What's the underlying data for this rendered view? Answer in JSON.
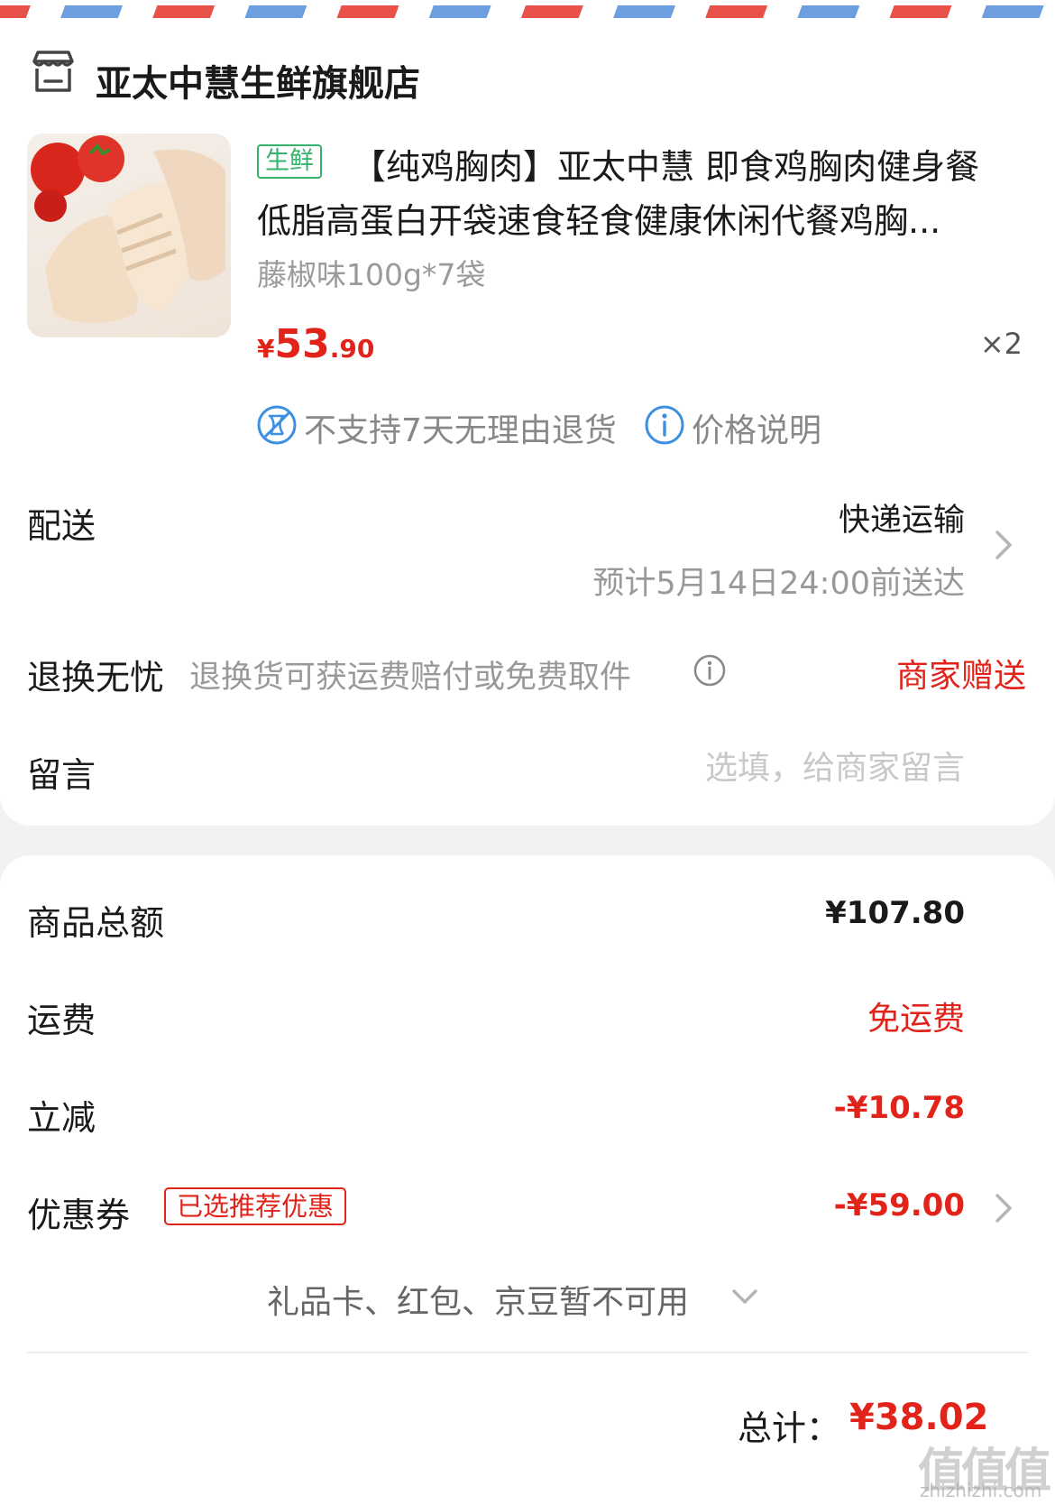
{
  "store": {
    "name": "亚太中慧生鲜旗舰店",
    "icon": "store-icon"
  },
  "product": {
    "tag": "生鲜",
    "title_line1": "【纯鸡胸肉】亚太中慧 即食鸡胸肉健身餐",
    "title_line2": "低脂高蛋白开袋速食轻食健康休闲代餐鸡胸...",
    "spec": "藤椒味100g*7袋",
    "price_currency": "¥",
    "price_int": "53",
    "price_dec": ".90",
    "quantity": "×2"
  },
  "notices": {
    "no_return": "不支持7天无理由退货",
    "price_info": "价格说明"
  },
  "delivery": {
    "label": "配送",
    "method": "快递运输",
    "eta": "预计5月14日24:00前送达"
  },
  "return_service": {
    "label": "退换无忧",
    "description": "退换货可获运费赔付或免费取件",
    "badge": "商家赠送"
  },
  "message": {
    "label": "留言",
    "placeholder": "选填，给商家留言"
  },
  "summary": {
    "goods_total_label": "商品总额",
    "goods_total_value": "¥107.80",
    "shipping_label": "运费",
    "shipping_value": "免运费",
    "discount_label": "立减",
    "discount_value": "-¥10.78",
    "coupon_label": "优惠券",
    "coupon_badge": "已选推荐优惠",
    "coupon_value": "-¥59.00",
    "gift_note": "礼品卡、红包、京豆暂不可用",
    "total_label": "总计：",
    "total_value": "¥38.02"
  },
  "watermark": {
    "text": "值值值",
    "sub": "zhizhizhi.com"
  },
  "colors": {
    "accent_red": "#e2231a",
    "fresh_green": "#35b36b",
    "info_blue": "#3d8fe0"
  }
}
